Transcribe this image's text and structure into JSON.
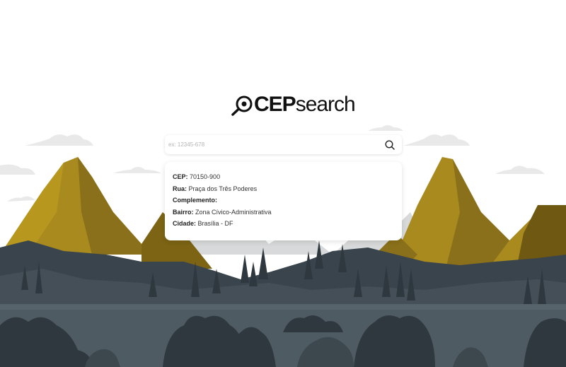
{
  "brand": {
    "logo_text_bold": "CEP",
    "logo_text_rest": "search"
  },
  "search": {
    "placeholder": "ex: 12345-678",
    "value": ""
  },
  "result": {
    "rows": [
      {
        "label": "CEP",
        "value": "70150-900"
      },
      {
        "label": "Rua",
        "value": "Praça dos Três Poderes"
      },
      {
        "label": "Complemento",
        "value": ""
      },
      {
        "label": "Bairro",
        "value": "Zona Cívico-Administrativa"
      },
      {
        "label": "Cidade",
        "value": "Brasília - DF"
      }
    ]
  },
  "colors": {
    "mountain_light": "#a98a1e",
    "mountain_dark": "#7c6414",
    "hills": "#3a444c",
    "ground": "#4f5b62",
    "foreground": "#2f383f"
  }
}
